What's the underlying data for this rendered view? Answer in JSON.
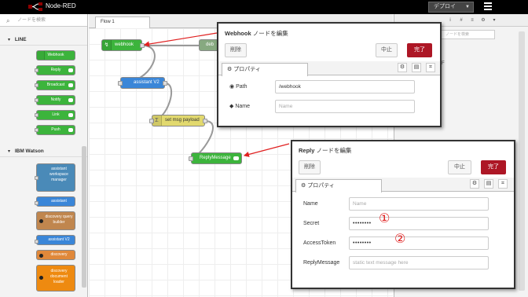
{
  "header": {
    "app_title": "Node-RED",
    "deploy_label": "デプロイ"
  },
  "palette": {
    "search_placeholder": "ノードを検索",
    "categories": [
      {
        "name": "LINE"
      },
      {
        "name": "IBM Watson"
      }
    ],
    "line_nodes": [
      "Webhook",
      "Reply",
      "Broadcast",
      "Notify",
      "Link",
      "Push"
    ],
    "watson_nodes": [
      {
        "label": "assistant workspace manager",
        "color": "#4a8ab8"
      },
      {
        "label": "assistant",
        "color": "#3a86d8"
      },
      {
        "label": "discovery query builder",
        "color": "#c0864e"
      },
      {
        "label": "assistant V2",
        "color": "#3a86d8"
      },
      {
        "label": "discovery",
        "color": "#e0883a"
      },
      {
        "label": "discovery document loader",
        "color": "#ee8a10"
      }
    ]
  },
  "workspace": {
    "tab_label": "Flow 1",
    "flow_nodes": {
      "webhook": "webhook",
      "assistant": "assistant V2",
      "setmsg": "set msg payload",
      "reply": "ReplyMessage",
      "partial": "deb"
    }
  },
  "sidebar": {
    "tab_icons": [
      "i",
      "#",
      "≡",
      "⚙",
      "▾"
    ],
    "search_placeholder": "ノードを検索",
    "item_label": "F"
  },
  "webhook_dialog": {
    "title_name": "Webhook",
    "title_suffix": " ノードを編集",
    "delete_label": "削除",
    "cancel_label": "中止",
    "done_label": "完了",
    "props_tab": "プロパティ",
    "fields": {
      "path_label": "Path",
      "path_value": "/webhook",
      "name_label": "Name",
      "name_placeholder": "Name"
    }
  },
  "reply_dialog": {
    "title_name": "Reply",
    "title_suffix": " ノードを編集",
    "delete_label": "削除",
    "cancel_label": "中止",
    "done_label": "完了",
    "props_tab": "プロパティ",
    "fields": {
      "name_label": "Name",
      "name_placeholder": "Name",
      "secret_label": "Secret",
      "secret_value": "••••••••",
      "token_label": "AccessToken",
      "token_value": "••••••••",
      "replymsg_label": "ReplyMessage",
      "replymsg_placeholder": "static text message here"
    }
  },
  "annotations": {
    "one": "①",
    "two": "②"
  },
  "colors": {
    "accent_red": "#ad1625",
    "arrow_red": "#e02020",
    "line_green": "#3cb43c",
    "assistant_blue": "#3a86d8",
    "function_yellow": "#e2d96e"
  }
}
